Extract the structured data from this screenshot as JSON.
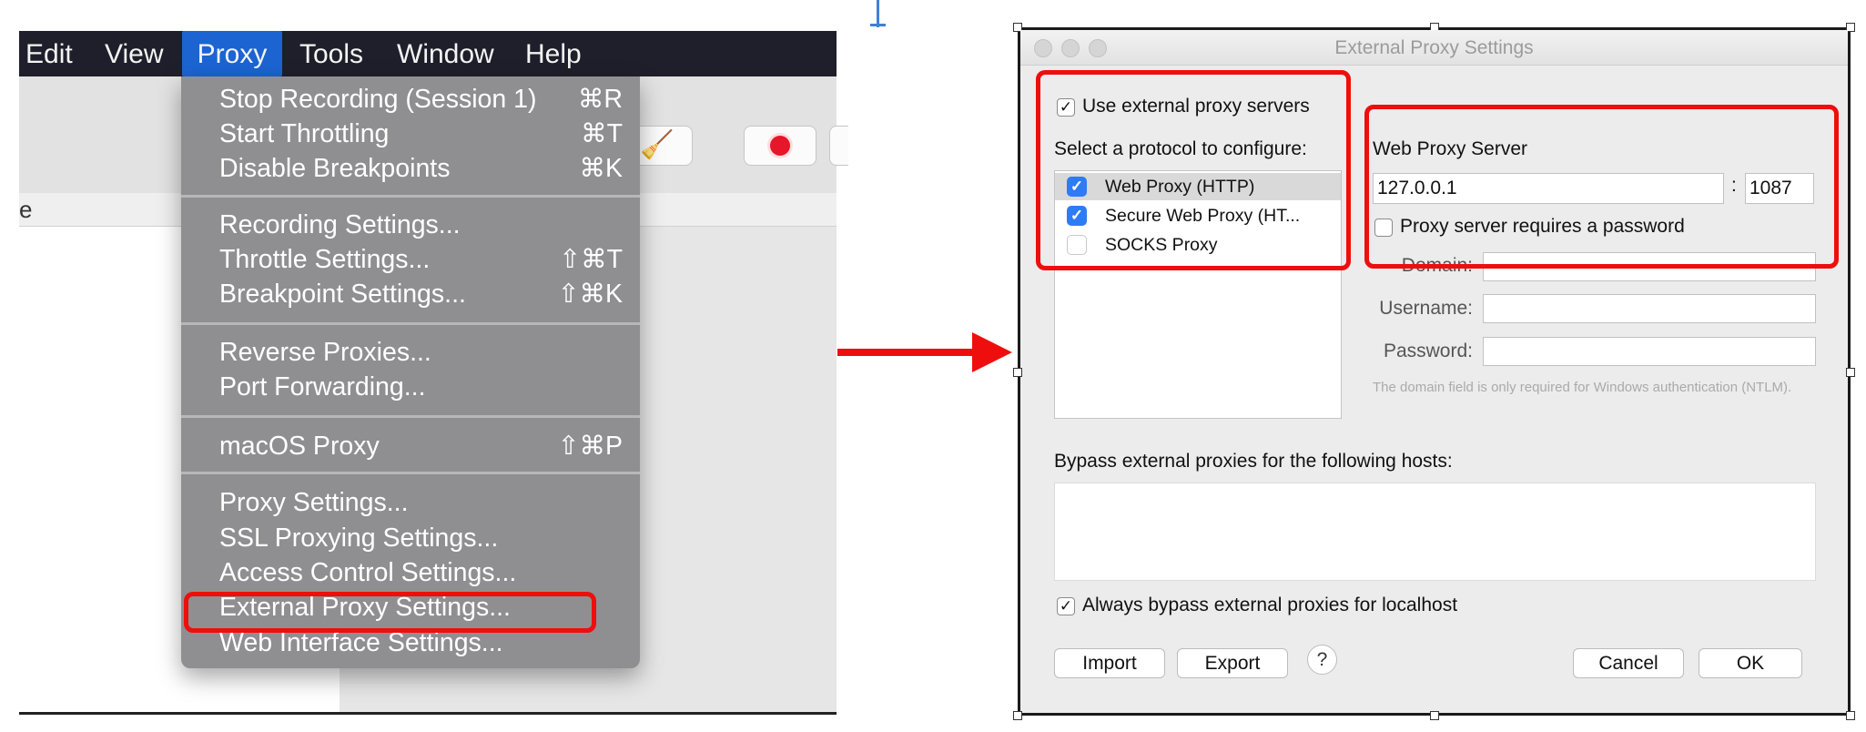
{
  "menubar": {
    "items": [
      "Edit",
      "View",
      "Proxy",
      "Tools",
      "Window",
      "Help"
    ],
    "active": "Proxy"
  },
  "app": {
    "column_header_fragment": "e"
  },
  "proxy_menu": {
    "items": [
      {
        "label": "Stop Recording (Session 1)",
        "shortcut": "⌘R"
      },
      {
        "label": "Start Throttling",
        "shortcut": "⌘T"
      },
      {
        "label": "Disable Breakpoints",
        "shortcut": "⌘K"
      },
      {
        "label": "Recording Settings...",
        "shortcut": ""
      },
      {
        "label": "Throttle Settings...",
        "shortcut": "⇧⌘T"
      },
      {
        "label": "Breakpoint Settings...",
        "shortcut": "⇧⌘K"
      },
      {
        "label": "Reverse Proxies...",
        "shortcut": ""
      },
      {
        "label": "Port Forwarding...",
        "shortcut": ""
      },
      {
        "label": "macOS Proxy",
        "shortcut": "⇧⌘P"
      },
      {
        "label": "Proxy Settings...",
        "shortcut": ""
      },
      {
        "label": "SSL Proxying Settings...",
        "shortcut": ""
      },
      {
        "label": "Access Control Settings...",
        "shortcut": ""
      },
      {
        "label": "External Proxy Settings...",
        "shortcut": ""
      },
      {
        "label": "Web Interface Settings...",
        "shortcut": ""
      }
    ],
    "highlighted": "External Proxy Settings..."
  },
  "dialog": {
    "title": "External Proxy Settings",
    "use_external_label": "Use external proxy servers",
    "use_external_checked": true,
    "protocol_heading": "Select a protocol to configure:",
    "protocols": [
      {
        "label": "Web Proxy (HTTP)",
        "checked": true,
        "selected": true
      },
      {
        "label": "Secure Web Proxy (HT...",
        "checked": true,
        "selected": false
      },
      {
        "label": "SOCKS Proxy",
        "checked": false,
        "selected": false
      }
    ],
    "server_heading": "Web Proxy Server",
    "host": "127.0.0.1",
    "port_separator": ":",
    "port": "1087",
    "requires_password_label": "Proxy server requires a password",
    "requires_password_checked": false,
    "domain_label": "Domain:",
    "username_label": "Username:",
    "password_label": "Password:",
    "domain_hint": "The domain field is only required for Windows authentication (NTLM).",
    "bypass_label": "Bypass external proxies for the following hosts:",
    "bypass_value": "",
    "always_bypass_label": "Always bypass external proxies for localhost",
    "always_bypass_checked": true,
    "buttons": {
      "import": "Import",
      "export": "Export",
      "help": "?",
      "cancel": "Cancel",
      "ok": "OK"
    }
  },
  "colors": {
    "annotation_red": "#ee0e0e",
    "menu_selection_blue": "#1b64d2",
    "checkbox_blue": "#2e7bf6"
  }
}
